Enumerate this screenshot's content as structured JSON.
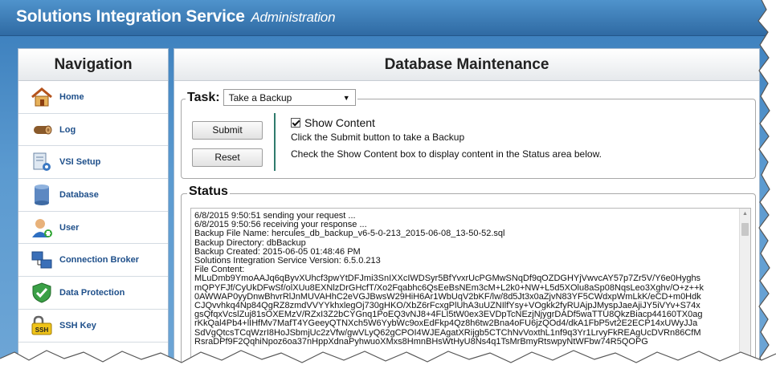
{
  "header": {
    "title": "Solutions Integration Service",
    "subtitle": "Administration",
    "bg_color": "#3a78b5"
  },
  "navigation": {
    "title": "Navigation",
    "items": [
      {
        "label": "Home",
        "icon": "house-icon"
      },
      {
        "label": "Log",
        "icon": "log-icon"
      },
      {
        "label": "VSI Setup",
        "icon": "setup-icon"
      },
      {
        "label": "Database",
        "icon": "database-icon"
      },
      {
        "label": "User",
        "icon": "user-icon"
      },
      {
        "label": "Connection Broker",
        "icon": "connection-broker-icon"
      },
      {
        "label": "Data Protection",
        "icon": "shield-icon"
      },
      {
        "label": "SSH Key",
        "icon": "ssh-key-icon"
      }
    ]
  },
  "main": {
    "title": "Database Maintenance",
    "task": {
      "label": "Task:",
      "selected": "Take a Backup"
    },
    "buttons": {
      "submit": "Submit",
      "reset": "Reset"
    },
    "show_content": {
      "label": "Show Content",
      "checked": true
    },
    "hints": [
      "Click the Submit button to take a Backup",
      "Check the Show Content box to display content in the Status area below."
    ],
    "status": {
      "label": "Status",
      "lines": [
        "6/8/2015 9:50:51 sending your request ...",
        "6/8/2015 9:50:56 receiving your response ...",
        "Backup File Name: hercules_db_backup_v6-5-0-213_2015-06-08_13-50-52.sql",
        "Backup Directory: dbBackup",
        "Backup Created: 2015-06-05 01:48:46 PM",
        "Solutions Integration Service Version: 6.5.0.213",
        "File Content:",
        "MLuDmb9YmoAAJq6qByvXUhcf3pwYtDFJmi3SnIXXcIWDSyr5BfYvxrUcPGMwSNqDf9qOZDGHYjVwvcAY57p7Zr5V/Y6e0Hyghs",
        "mQPYFJf/CyUkDFwSf/olXUu8EXNlzDrGHcfT/Xo2Fqabhc6QsEeBsNEm3cM+L2k0+NW+L5d5XOlu8aSp08NqsLeo3Xghv/O+z++k",
        "0AWWAP0yyDnwBhvrRlJnMUVAHhC2eVGJBwsW29HiH6Ar1WbUqV2bKF/lw/8d5Jt3x0aZjvN83YF5CWdxpWmLkK/eCD+m0Hdk",
        "CJQvvhkq4Np84QgRZ8zmdVVYYkhxlegOj730gHKO/XbZ6rFcxgPlUhA3uUZNIlfYsy+VOgkk2fyRUAjpJMyspJaeAjiJY5iVYv+S74x",
        "gsQfqxVcslZuj81sOXEMzV/RZxI3Z2bCYGnq1PoEQ3vNJ8+4FLI5tW0ex3EVDpTcNEzjNjygrDADf5waTTU8QkzBiacp44160TX0ag",
        "rKkQal4Pb4+lIHfMv7MafT4YGeeyQTNXch5W6YybWc9oxEdFkp4Qz8h6tw2Bna4oFU6jzQOd4/dkA1FbP5vt2E2ECP14xUWyJJa",
        "SdVgQtcsTCqWzrI8HoJSbmjUc2zVfw/gwVLyQ62gCPOI4WJEAgatXRijgb5CTChNvVoxthL1nf9q3Yr1LrvyFkREAgUcDVRn86CfM",
        "RsraDPf9F2QqhiNpoz6oa37nHppXdnaPyhwuoXMxs8HmnBHsWtHyU8Ns4q1TsMrBmyRtswpyNtWFbw74R5QOPG"
      ]
    }
  }
}
